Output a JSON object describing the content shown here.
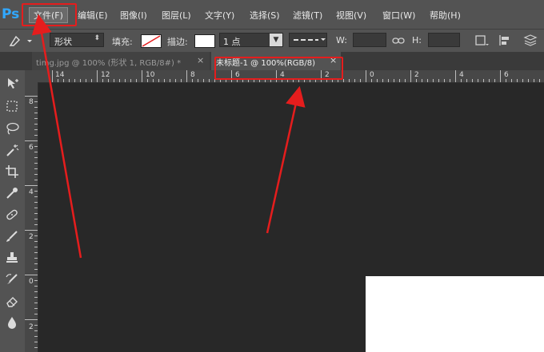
{
  "app": {
    "logo": "Ps"
  },
  "menu": {
    "items": [
      {
        "label": "文件(F)",
        "active": true
      },
      {
        "label": "编辑(E)"
      },
      {
        "label": "图像(I)"
      },
      {
        "label": "图层(L)"
      },
      {
        "label": "文字(Y)"
      },
      {
        "label": "选择(S)"
      },
      {
        "label": "滤镜(T)"
      },
      {
        "label": "视图(V)"
      },
      {
        "label": "窗口(W)"
      },
      {
        "label": "帮助(H)"
      }
    ]
  },
  "options": {
    "mode_value": "形状",
    "fill_label": "填充:",
    "stroke_label": "描边:",
    "stroke_width_value": "1 点",
    "w_label": "W:",
    "h_label": "H:"
  },
  "tabs": [
    {
      "label": "timg.jpg @ 100% (形状 1, RGB/8#) *",
      "close": "×",
      "active": false
    },
    {
      "label": "未标题-1 @ 100%(RGB/8)",
      "close": "×",
      "active": true
    }
  ],
  "ruler": {
    "h_labels": [
      "14",
      "12",
      "10",
      "8",
      "6",
      "4",
      "2",
      "0",
      "2",
      "4",
      "6"
    ],
    "v_labels": [
      "8",
      "6",
      "4",
      "2",
      "0",
      "2"
    ]
  },
  "colors": {
    "annotation": "#e51d1d",
    "accent": "#31a8ff"
  },
  "tools": [
    "move-icon",
    "marquee-icon",
    "lasso-icon",
    "magic-wand-icon",
    "crop-icon",
    "eyedropper-icon",
    "healing-brush-icon",
    "brush-icon",
    "stamp-icon",
    "history-brush-icon",
    "eraser-icon",
    "blur-icon"
  ]
}
